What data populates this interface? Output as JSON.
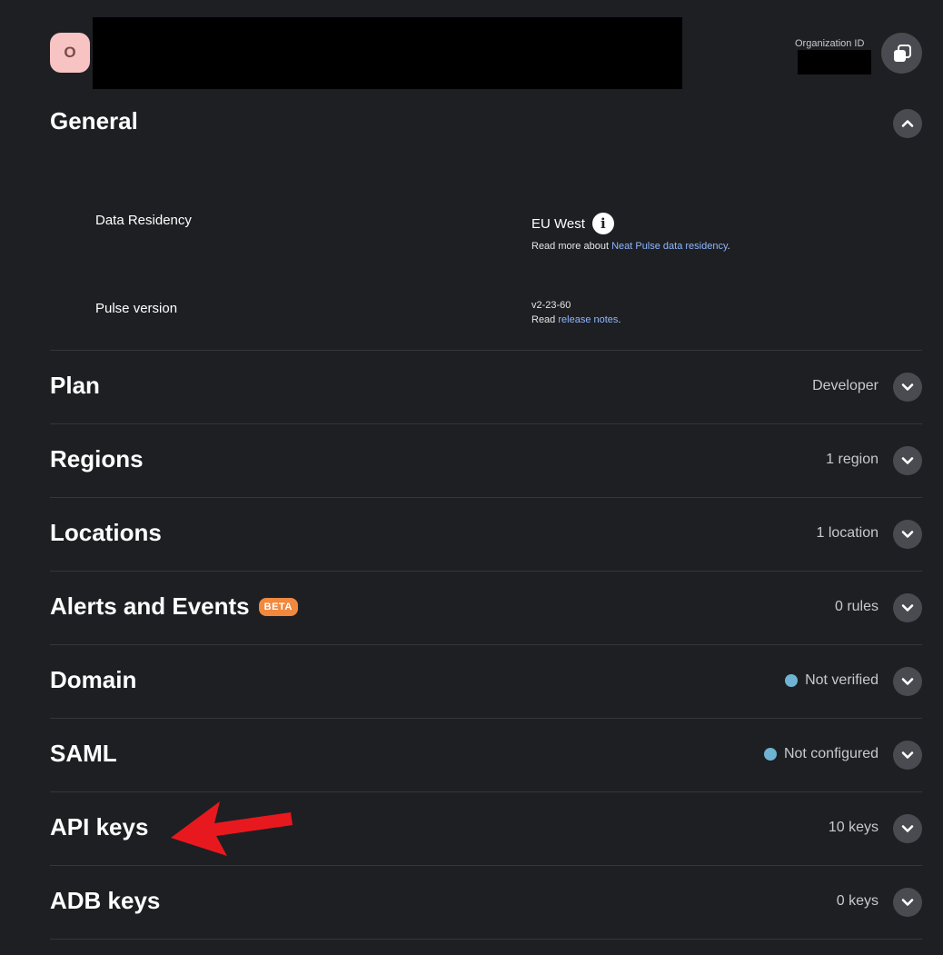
{
  "header": {
    "org_initial": "O",
    "org_id_label": "Organization ID"
  },
  "general": {
    "title": "General",
    "data_residency_label": "Data Residency",
    "data_residency_value": "EU West",
    "data_residency_note_prefix": "Read more about ",
    "data_residency_link": "Neat Pulse data residency",
    "data_residency_note_suffix": ".",
    "pulse_version_label": "Pulse version",
    "pulse_version_value": "v2-23-60",
    "release_prefix": "Read ",
    "release_link": "release notes",
    "release_suffix": "."
  },
  "rows": {
    "plan": {
      "title": "Plan",
      "value": "Developer"
    },
    "regions": {
      "title": "Regions",
      "value": "1 region"
    },
    "locations": {
      "title": "Locations",
      "value": "1 location"
    },
    "alerts": {
      "title": "Alerts and Events",
      "badge": "BETA",
      "value": "0 rules"
    },
    "domain": {
      "title": "Domain",
      "value": "Not verified"
    },
    "saml": {
      "title": "SAML",
      "value": "Not configured"
    },
    "api_keys": {
      "title": "API keys",
      "value": "10 keys"
    },
    "adb_keys": {
      "title": "ADB keys",
      "value": "0 keys"
    }
  },
  "colors": {
    "background": "#1e1f23",
    "avatar_bg": "#f8c3c3",
    "link": "#8fb6ff",
    "beta_badge": "#f0883e",
    "status_dot": "#6fb3d2",
    "annotation_arrow": "#e8191e"
  },
  "icons": {
    "copy": "copy-icon",
    "info": "info-icon",
    "collapse": "chevron-up-icon",
    "expand": "chevron-down-icon",
    "annotation": "red-arrow-annotation"
  }
}
